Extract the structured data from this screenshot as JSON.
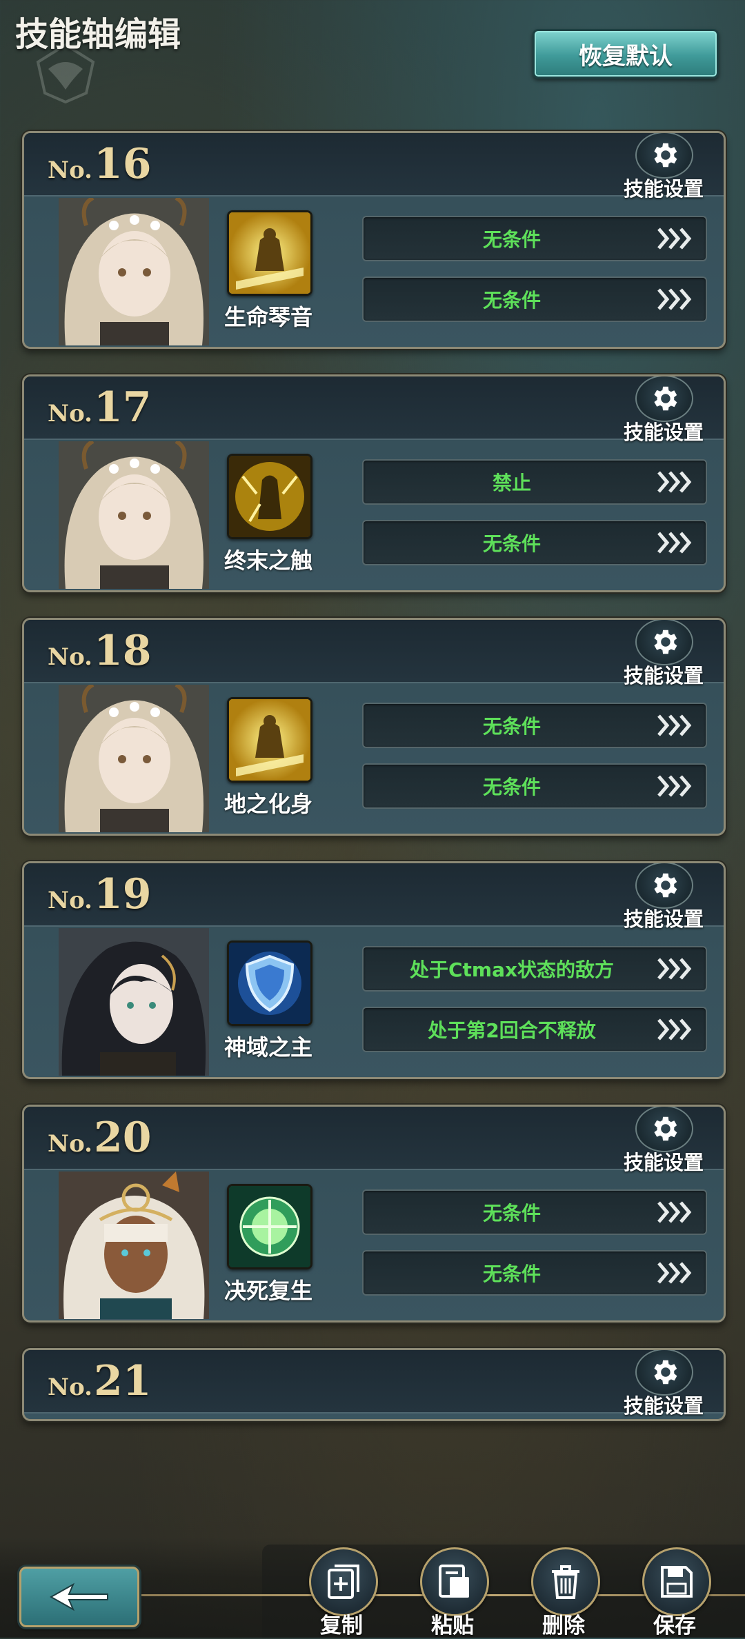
{
  "header": {
    "title": "技能轴编辑",
    "restore_label": "恢复默认"
  },
  "settings_label": "技能设置",
  "cards": [
    {
      "prefix": "No.",
      "number": "16",
      "skill": "生命琴音",
      "conditions": [
        "无条件",
        "无条件"
      ]
    },
    {
      "prefix": "No.",
      "number": "17",
      "skill": "终末之触",
      "conditions": [
        "禁止",
        "无条件"
      ]
    },
    {
      "prefix": "No.",
      "number": "18",
      "skill": "地之化身",
      "conditions": [
        "无条件",
        "无条件"
      ]
    },
    {
      "prefix": "No.",
      "number": "19",
      "skill": "神域之主",
      "conditions": [
        "处于Ctmax状态的敌方",
        "处于第2回合不释放"
      ]
    },
    {
      "prefix": "No.",
      "number": "20",
      "skill": "决死复生",
      "conditions": [
        "无条件",
        "无条件"
      ]
    },
    {
      "prefix": "No.",
      "number": "21"
    }
  ],
  "toolbar": {
    "copy_label": "复制",
    "paste_label": "粘贴",
    "delete_label": "删除",
    "save_label": "保存"
  },
  "colors": {
    "condition_text": "#5ee05a",
    "number_gold": "#e9d6a2",
    "restore_button": "#3f9a99"
  }
}
